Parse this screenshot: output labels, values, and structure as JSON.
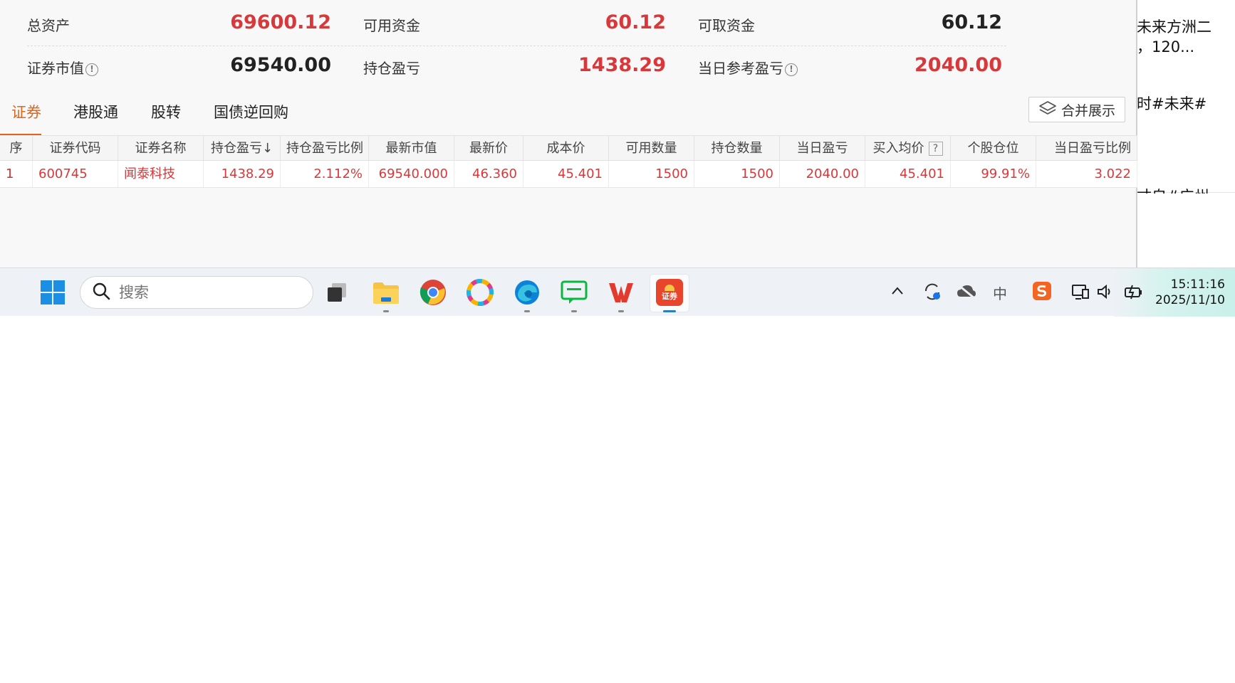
{
  "background_window": {
    "lines": [
      "未来方洲二",
      "，120...",
      "时#未来#",
      "寸自#广州"
    ]
  },
  "summary": {
    "total_assets_label": "总资产",
    "total_assets_value": "69600.12",
    "available_funds_label": "可用资金",
    "available_funds_value": "60.12",
    "withdrawable_label": "可取资金",
    "withdrawable_value": "60.12",
    "market_value_label": "证券市值",
    "market_value_value": "69540.00",
    "position_pnl_label": "持仓盈亏",
    "position_pnl_value": "1438.29",
    "daily_ref_pnl_label": "当日参考盈亏",
    "daily_ref_pnl_value": "2040.00",
    "info_glyph": "!"
  },
  "tabs": {
    "items": [
      "证券",
      "港股通",
      "股转",
      "国债逆回购"
    ],
    "active": "证券",
    "merge_button": "合并展示"
  },
  "table": {
    "headers": [
      "序",
      "证券代码",
      "证券名称",
      "持仓盈亏↓",
      "持仓盈亏比例",
      "最新市值",
      "最新价",
      "成本价",
      "可用数量",
      "持仓数量",
      "当日盈亏",
      "买入均价",
      "个股仓位",
      "当日盈亏比例"
    ],
    "help_badge": "?",
    "rows": [
      [
        "1",
        "600745",
        "闻泰科技",
        "1438.29",
        "2.112%",
        "69540.000",
        "46.360",
        "45.401",
        "1500",
        "1500",
        "2040.00",
        "45.401",
        "99.91%",
        "3.022"
      ]
    ]
  },
  "taskbar": {
    "search_placeholder": "搜索",
    "apps": [
      "start-menu",
      "task-view",
      "file-explorer",
      "chrome",
      "photos",
      "edge",
      "wechat-work",
      "wps",
      "securities-app"
    ],
    "app_badge_text": "证券",
    "ime_label": "中",
    "time": "15:11:16",
    "date": "2025/11/10"
  },
  "colors": {
    "accent_orange": "#e0661c",
    "loss_profit_red": "#d9383a",
    "taskbar_bg": "#eef1f5"
  }
}
